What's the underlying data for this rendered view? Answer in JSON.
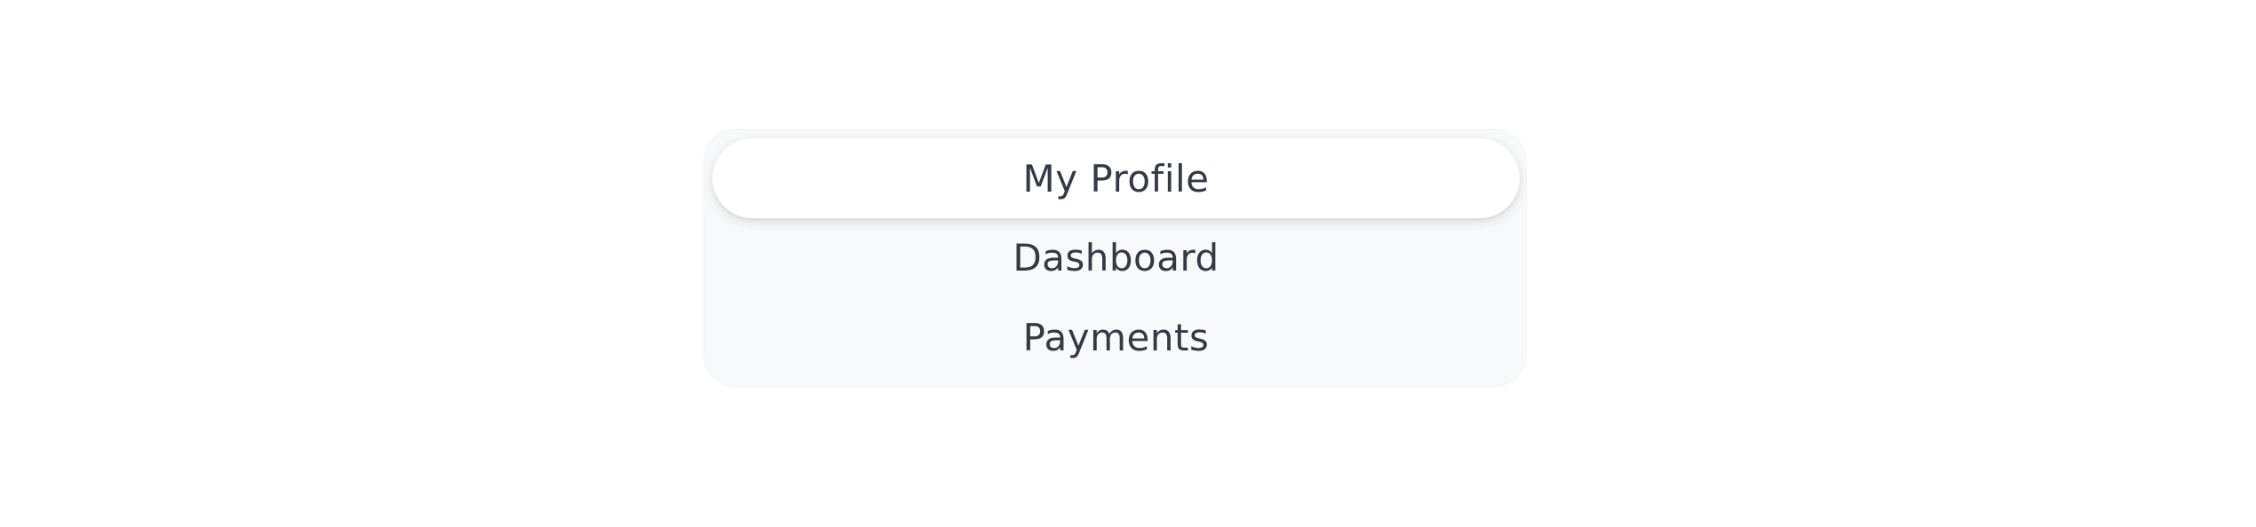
{
  "menu": {
    "items": [
      {
        "label": "My Profile",
        "selected": true
      },
      {
        "label": "Dashboard",
        "selected": false
      },
      {
        "label": "Payments",
        "selected": false
      }
    ]
  },
  "colors": {
    "page_background": "#ffffff",
    "menu_background": "#f8f9fa",
    "active_item_background": "#ffffff",
    "text": "#343a44"
  }
}
